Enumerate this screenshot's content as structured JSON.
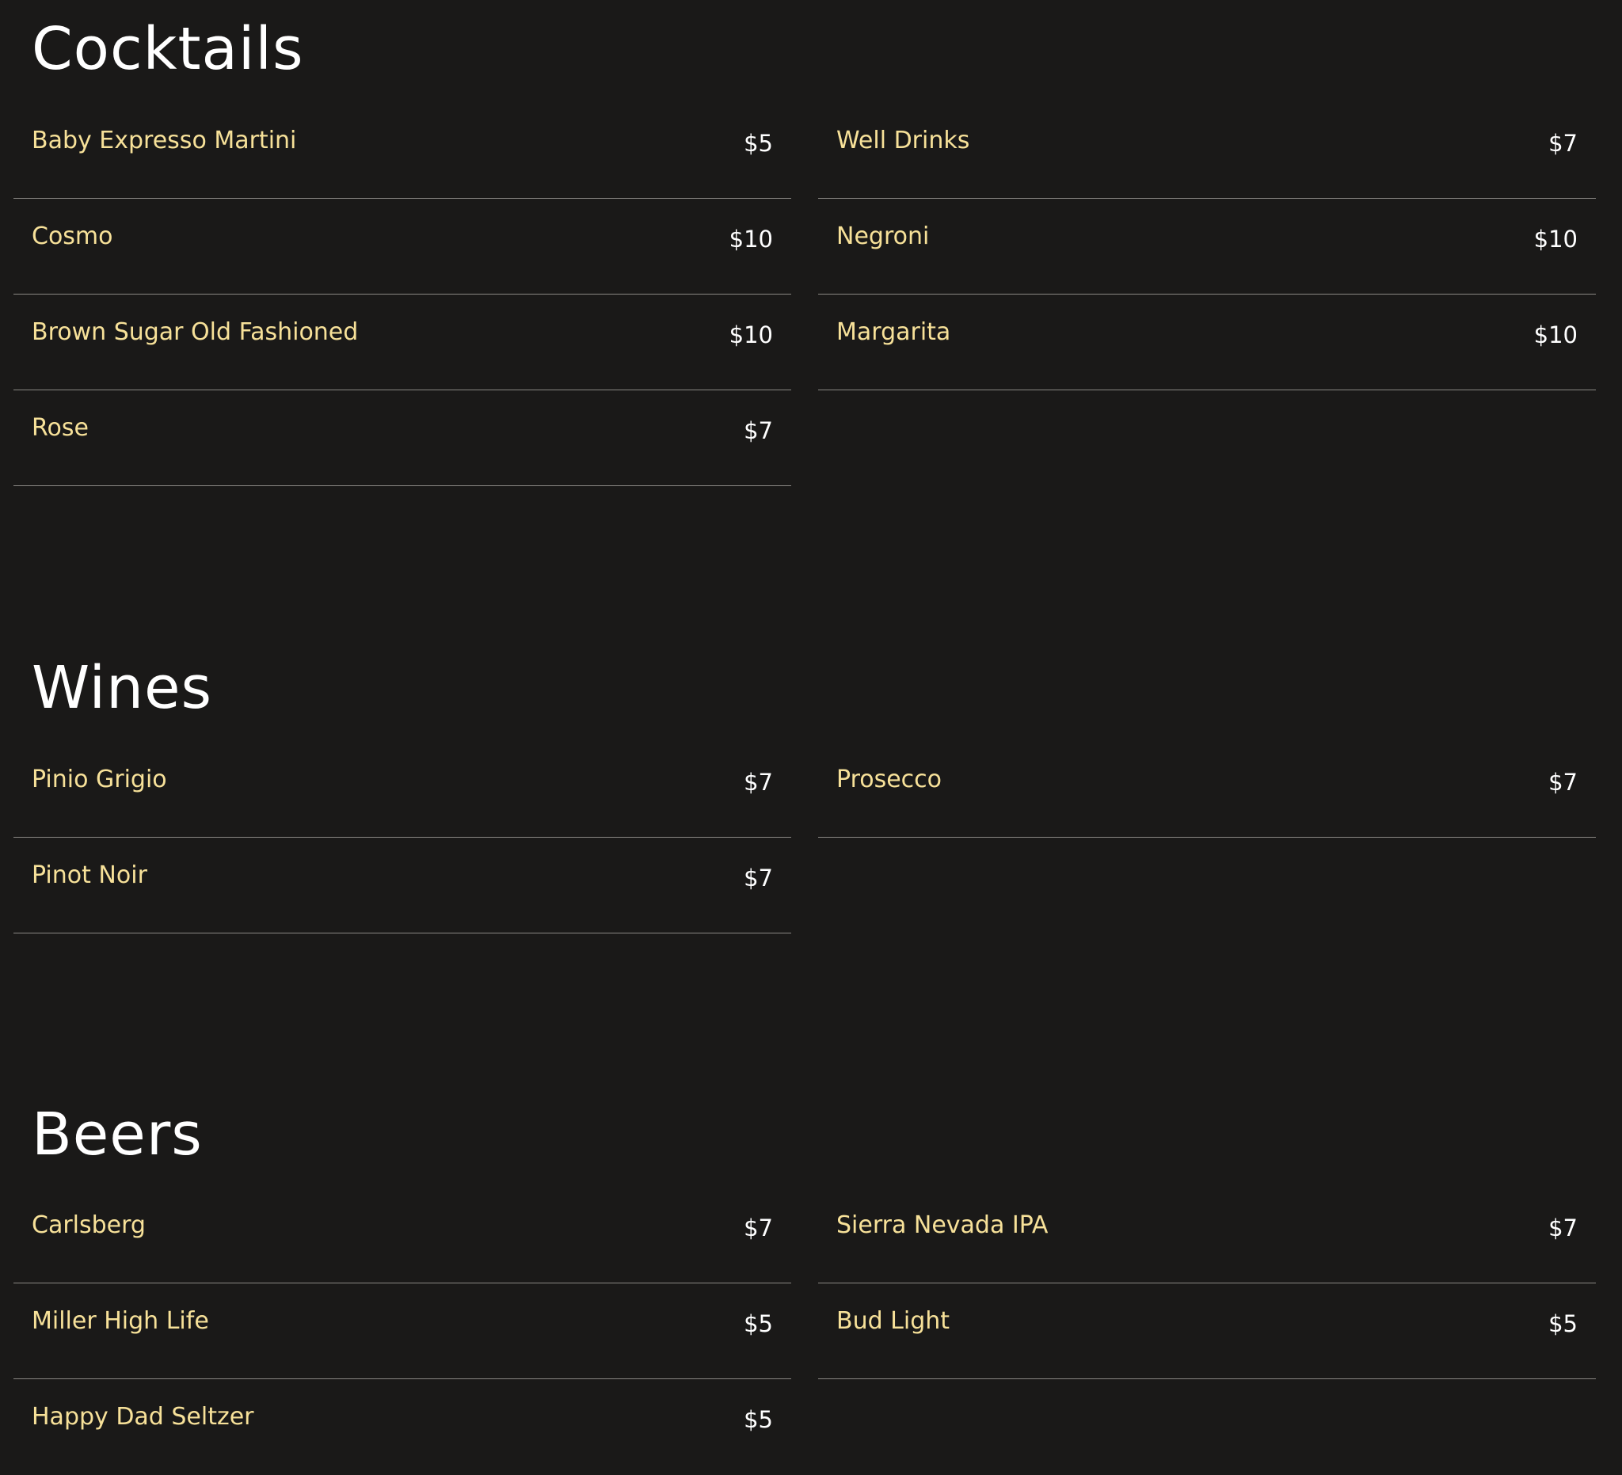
{
  "colors": {
    "background": "#1a1918",
    "heading": "#ffffff",
    "item_name": "#f7e199",
    "price": "#ffffff",
    "divider": "#8a8884"
  },
  "sections": [
    {
      "title": "Cocktails",
      "left": [
        {
          "name": "Baby Expresso Martini",
          "price": "$5"
        },
        {
          "name": "Cosmo",
          "price": "$10"
        },
        {
          "name": "Brown Sugar Old Fashioned",
          "price": "$10"
        },
        {
          "name": "Rose",
          "price": "$7"
        }
      ],
      "right": [
        {
          "name": "Well Drinks",
          "price": "$7"
        },
        {
          "name": "Negroni",
          "price": "$10"
        },
        {
          "name": "Margarita",
          "price": "$10"
        }
      ]
    },
    {
      "title": "Wines",
      "left": [
        {
          "name": "Pinio Grigio",
          "price": "$7"
        },
        {
          "name": "Pinot Noir",
          "price": "$7"
        }
      ],
      "right": [
        {
          "name": "Prosecco",
          "price": "$7"
        }
      ]
    },
    {
      "title": "Beers",
      "left": [
        {
          "name": "Carlsberg",
          "price": "$7"
        },
        {
          "name": "Miller High Life",
          "price": "$5"
        },
        {
          "name": "Happy Dad Seltzer",
          "price": "$5"
        }
      ],
      "right": [
        {
          "name": "Sierra Nevada IPA",
          "price": "$7"
        },
        {
          "name": "Bud Light",
          "price": "$5"
        }
      ]
    }
  ]
}
